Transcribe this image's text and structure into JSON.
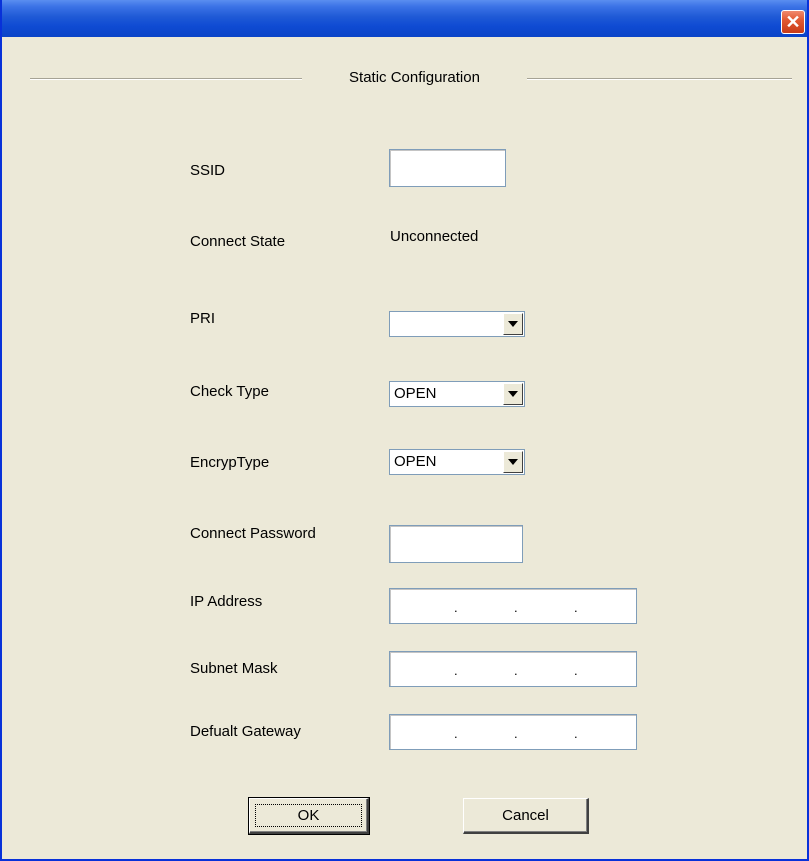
{
  "window": {
    "close_glyph": "✕"
  },
  "group": {
    "title": "Static Configuration"
  },
  "fields": {
    "ssid": {
      "label": "SSID",
      "value": ""
    },
    "connect_state": {
      "label": "Connect State",
      "value": "Unconnected"
    },
    "pri": {
      "label": "PRI",
      "selected": ""
    },
    "check_type": {
      "label": "Check Type",
      "selected": "OPEN"
    },
    "encryp_type": {
      "label": "EncrypType",
      "selected": "OPEN"
    },
    "connect_password": {
      "label": "Connect Password",
      "value": ""
    },
    "ip_address": {
      "label": "IP Address",
      "octets": [
        "",
        "",
        "",
        ""
      ]
    },
    "subnet_mask": {
      "label": "Subnet Mask",
      "octets": [
        "",
        "",
        "",
        ""
      ]
    },
    "default_gateway": {
      "label": "Defualt Gateway",
      "octets": [
        "",
        "",
        "",
        ""
      ]
    }
  },
  "ip_separator": ".",
  "buttons": {
    "ok_label": "OK",
    "cancel_label": "Cancel"
  },
  "colors": {
    "titlebar": "#0a44c8",
    "window_bg": "#ece9d8",
    "close_button": "#e25a33"
  }
}
